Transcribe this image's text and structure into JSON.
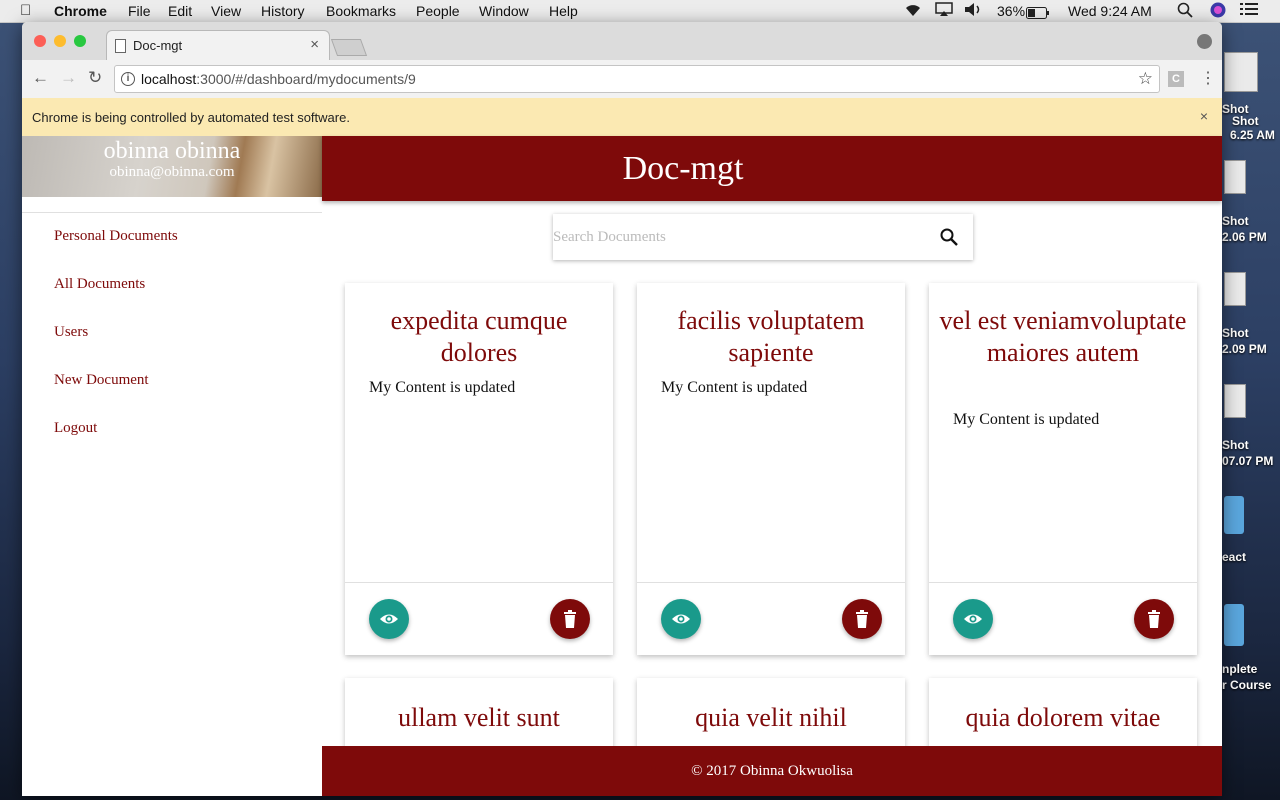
{
  "menubar": {
    "app": "Chrome",
    "items": [
      "File",
      "Edit",
      "View",
      "History",
      "Bookmarks",
      "People",
      "Window",
      "Help"
    ],
    "battery": "36%",
    "clock": "Wed 9:24 AM"
  },
  "desktop": {
    "labels": [
      "Shot",
      "Shot",
      "6.25 AM",
      "Shot",
      "2.06 PM",
      "Shot",
      "2.09 PM",
      "Shot",
      "07.07 PM",
      "eact",
      "nplete",
      "r Course"
    ]
  },
  "browser": {
    "tab_title": "Doc-mgt",
    "url_host": "localhost",
    "url_path": ":3000/#/dashboard/mydocuments/9",
    "extension_label": "C",
    "infobar_message": "Chrome is being controlled by automated test software."
  },
  "sidebar": {
    "user_name": "obinna obinna",
    "user_email": "obinna@obinna.com",
    "links": [
      "Personal Documents",
      "All Documents",
      "Users",
      "New Document",
      "Logout"
    ]
  },
  "header": {
    "brand": "Doc-mgt"
  },
  "search": {
    "placeholder": "Search Documents"
  },
  "documents": [
    {
      "title": "expedita cumque dolores",
      "content": "My Content is updated"
    },
    {
      "title": "facilis voluptatem sapiente",
      "content": "My Content is updated"
    },
    {
      "title": "vel est veniamvoluptate maiores autem",
      "content": "My Content is updated"
    },
    {
      "title": "ullam velit sunt",
      "content": ""
    },
    {
      "title": "quia velit nihil",
      "content": ""
    },
    {
      "title": "quia dolorem vitae",
      "content": ""
    }
  ],
  "footer": {
    "text": "© 2017 Obinna Okwuolisa"
  },
  "colors": {
    "brand": "#7e0a0a",
    "view_button": "#1a9a8b",
    "infobar": "#fbe9b2"
  }
}
